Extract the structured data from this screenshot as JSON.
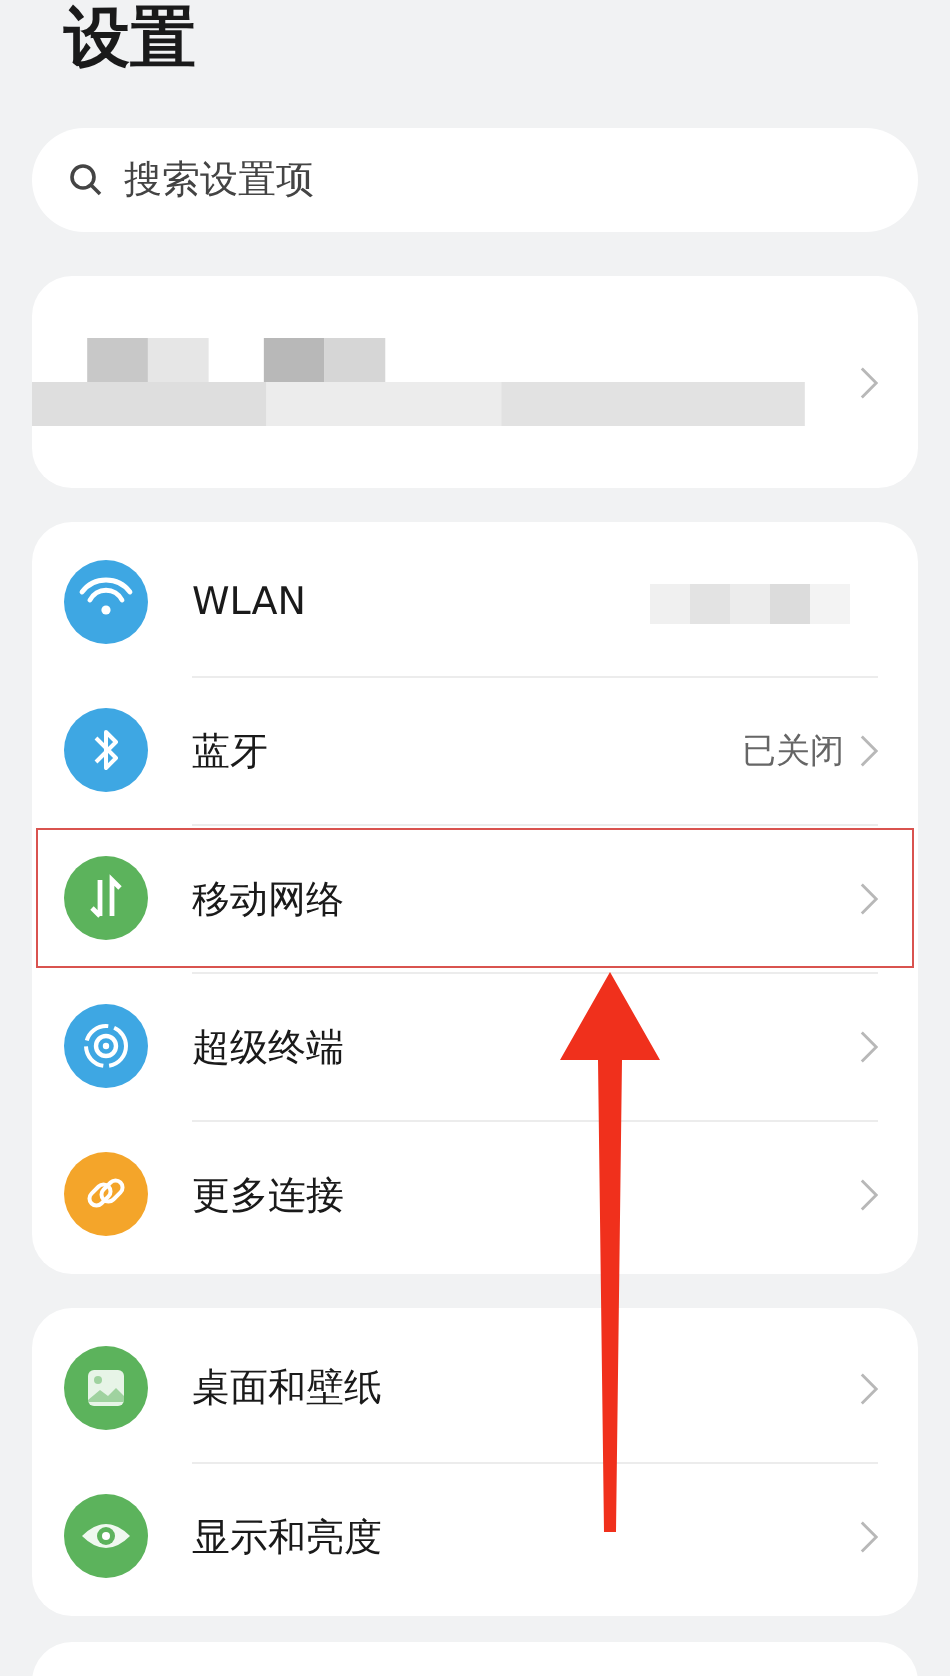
{
  "title": "设置",
  "search": {
    "placeholder": "搜索设置项"
  },
  "groups": [
    {
      "items": [
        {
          "label": "WLAN",
          "color": "#3ea7e3",
          "redacted": true,
          "highlighted": false
        },
        {
          "label": "蓝牙",
          "color": "#3ea7e3",
          "value": "已关闭",
          "redacted": false,
          "highlighted": false
        },
        {
          "label": "移动网络",
          "color": "#5cb35c",
          "redacted": false,
          "highlighted": true
        },
        {
          "label": "超级终端",
          "color": "#3ea7e3",
          "redacted": false,
          "highlighted": false
        },
        {
          "label": "更多连接",
          "color": "#f4a52a",
          "redacted": false,
          "highlighted": false
        }
      ]
    },
    {
      "items": [
        {
          "label": "桌面和壁纸",
          "color": "#5cb35c",
          "redacted": false,
          "highlighted": false
        },
        {
          "label": "显示和亮度",
          "color": "#5cb35c",
          "redacted": false,
          "highlighted": false
        }
      ]
    }
  ]
}
